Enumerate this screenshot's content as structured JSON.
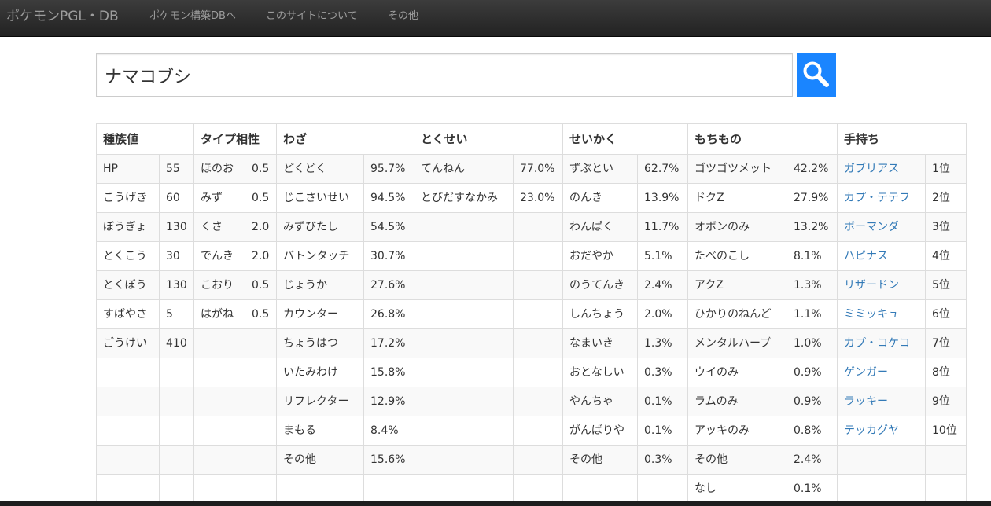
{
  "navbar": {
    "brand": "ポケモンPGL・DB",
    "links": [
      "ポケモン構築DBへ",
      "このサイトについて",
      "その他"
    ]
  },
  "search": {
    "value": "ナマコブシ",
    "button_color": "#1a85ff"
  },
  "table": {
    "headers": [
      "種族値",
      "タイプ相性",
      "わざ",
      "とくせい",
      "せいかく",
      "もちもの",
      "手持ち"
    ],
    "rows": [
      [
        "HP",
        "55",
        "ほのお",
        "0.5",
        "どくどく",
        "95.7%",
        "てんねん",
        "77.0%",
        "ずぶとい",
        "62.7%",
        "ゴツゴツメット",
        "42.2%",
        "ガブリアス",
        "1位"
      ],
      [
        "こうげき",
        "60",
        "みず",
        "0.5",
        "じこさいせい",
        "94.5%",
        "とびだすなかみ",
        "23.0%",
        "のんき",
        "13.9%",
        "ドクZ",
        "27.9%",
        "カプ・テテフ",
        "2位"
      ],
      [
        "ぼうぎょ",
        "130",
        "くさ",
        "2.0",
        "みずびたし",
        "54.5%",
        "",
        "",
        "わんぱく",
        "11.7%",
        "オボンのみ",
        "13.2%",
        "ボーマンダ",
        "3位"
      ],
      [
        "とくこう",
        "30",
        "でんき",
        "2.0",
        "バトンタッチ",
        "30.7%",
        "",
        "",
        "おだやか",
        "5.1%",
        "たべのこし",
        "8.1%",
        "ハピナス",
        "4位"
      ],
      [
        "とくぼう",
        "130",
        "こおり",
        "0.5",
        "じょうか",
        "27.6%",
        "",
        "",
        "のうてんき",
        "2.4%",
        "アクZ",
        "1.3%",
        "リザードン",
        "5位"
      ],
      [
        "すばやさ",
        "5",
        "はがね",
        "0.5",
        "カウンター",
        "26.8%",
        "",
        "",
        "しんちょう",
        "2.0%",
        "ひかりのねんど",
        "1.1%",
        "ミミッキュ",
        "6位"
      ],
      [
        "ごうけい",
        "410",
        "",
        "",
        "ちょうはつ",
        "17.2%",
        "",
        "",
        "なまいき",
        "1.3%",
        "メンタルハーブ",
        "1.0%",
        "カプ・コケコ",
        "7位"
      ],
      [
        "",
        "",
        "",
        "",
        "いたみわけ",
        "15.8%",
        "",
        "",
        "おとなしい",
        "0.3%",
        "ウイのみ",
        "0.9%",
        "ゲンガー",
        "8位"
      ],
      [
        "",
        "",
        "",
        "",
        "リフレクター",
        "12.9%",
        "",
        "",
        "やんちゃ",
        "0.1%",
        "ラムのみ",
        "0.9%",
        "ラッキー",
        "9位"
      ],
      [
        "",
        "",
        "",
        "",
        "まもる",
        "8.4%",
        "",
        "",
        "がんばりや",
        "0.1%",
        "アッキのみ",
        "0.8%",
        "テッカグヤ",
        "10位"
      ],
      [
        "",
        "",
        "",
        "",
        "その他",
        "15.6%",
        "",
        "",
        "その他",
        "0.3%",
        "その他",
        "2.4%",
        "",
        ""
      ],
      [
        "",
        "",
        "",
        "",
        "",
        "",
        "",
        "",
        "",
        "",
        "なし",
        "0.1%",
        "",
        ""
      ]
    ]
  },
  "colors": {
    "link": "#337ab7",
    "navbar": "#222222",
    "stripe": "#f9f9f9"
  }
}
